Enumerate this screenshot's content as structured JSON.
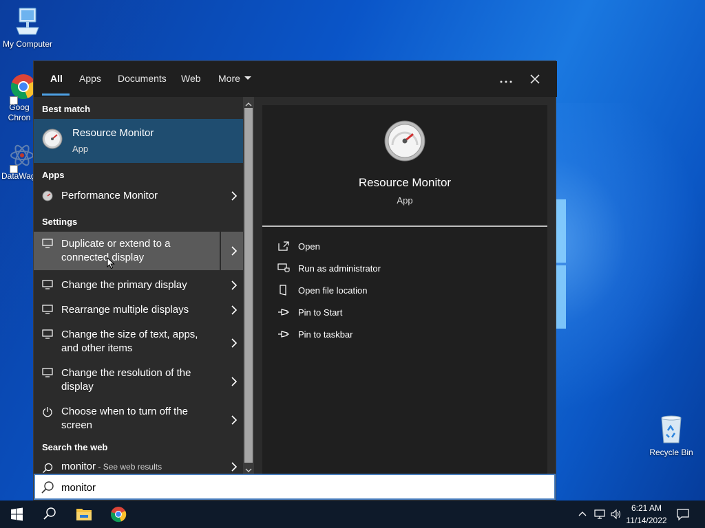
{
  "desktop": {
    "icons": [
      {
        "label": "My Computer"
      },
      {
        "label": "Goog Chron"
      },
      {
        "label": "DataWag"
      },
      {
        "label": "Recycle Bin"
      }
    ]
  },
  "search": {
    "tabs": [
      "All",
      "Apps",
      "Documents",
      "Web",
      "More"
    ],
    "active_tab": "All",
    "best_match_header": "Best match",
    "best_match": {
      "name": "Resource Monitor",
      "type": "App"
    },
    "apps_header": "Apps",
    "apps": [
      {
        "name": "Performance Monitor"
      }
    ],
    "settings_header": "Settings",
    "settings": [
      {
        "line1": "Duplicate or extend to a",
        "line2": "connected display"
      },
      {
        "line1": "Change the primary display",
        "line2": ""
      },
      {
        "line1": "Rearrange multiple displays",
        "line2": ""
      },
      {
        "line1": "Change the size of text, apps,",
        "line2": "and other items"
      },
      {
        "line1": "Change the resolution of the",
        "line2": "display"
      },
      {
        "line1": "Choose when to turn off the",
        "line2": "screen"
      }
    ],
    "web_header": "Search the web",
    "web_result": {
      "query": "monitor",
      "suffix": " - See web results"
    },
    "preview": {
      "title": "Resource Monitor",
      "type": "App",
      "actions": [
        "Open",
        "Run as administrator",
        "Open file location",
        "Pin to Start",
        "Pin to taskbar"
      ]
    },
    "input_value": "monitor"
  },
  "taskbar": {
    "time": "6:21 AM",
    "date": "11/14/2022"
  },
  "colors": {
    "accent": "#4ea2e6",
    "selected_row": "#1f4d70",
    "panel_bg": "#2b2b2b"
  }
}
